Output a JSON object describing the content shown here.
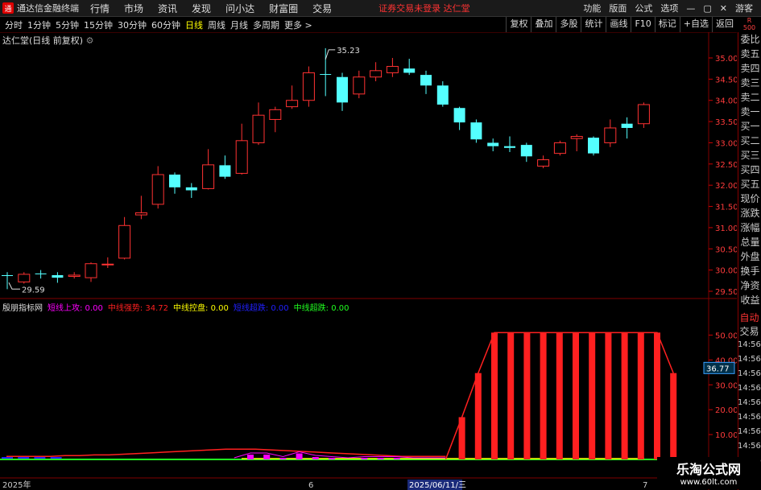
{
  "app": {
    "title": "通达信金融终端",
    "menus": [
      "行情",
      "市场",
      "资讯",
      "发现",
      "问小达",
      "财富圈",
      "交易"
    ],
    "notice": "证券交易未登录  达仁堂",
    "right_menus": [
      "功能",
      "版面",
      "公式",
      "选项"
    ],
    "guest": "游客"
  },
  "periods": {
    "items": [
      "分时",
      "1分钟",
      "5分钟",
      "15分钟",
      "30分钟",
      "60分钟",
      "日线",
      "周线",
      "月线",
      "多周期",
      "更多 >"
    ],
    "active": "日线"
  },
  "tools": [
    "复权",
    "叠加",
    "多股",
    "统计",
    "画线",
    "F10",
    "标记",
    "+自选",
    "返回"
  ],
  "right_top": {
    "line1": "R",
    "line2": "500"
  },
  "stock_title": "达仁堂(日线 前复权)",
  "price_axis": [
    "35.00",
    "34.50",
    "34.00",
    "33.50",
    "33.00",
    "32.50",
    "32.00",
    "31.50",
    "31.00",
    "30.50",
    "30.00",
    "29.50"
  ],
  "annotations": {
    "high": "35.23",
    "low": "29.59"
  },
  "right_panel": [
    "委比",
    "卖五",
    "卖四",
    "卖三",
    "卖二",
    "卖一",
    "买一",
    "买二",
    "买三",
    "买四",
    "买五",
    "现价",
    "涨跌",
    "涨幅",
    "总量",
    "外盘",
    "换手",
    "净资",
    "收益"
  ],
  "indicator": {
    "name": "殷朋指标网",
    "items": [
      {
        "label": "短线上攻: 0.00",
        "color": "#ff00ff"
      },
      {
        "label": "中线强势: 34.72",
        "color": "#ff2020"
      },
      {
        "label": "中线控盘: 0.00",
        "color": "#ffff00"
      },
      {
        "label": "短线超跌: 0.00",
        "color": "#2020ff"
      },
      {
        "label": "中线超跌: 0.00",
        "color": "#20ff20"
      }
    ],
    "axis": [
      "50.00",
      "40.00",
      "30.00",
      "20.00",
      "10.00"
    ],
    "current": "36.77"
  },
  "ind_side": {
    "auto": "自动",
    "trade": "交易",
    "times": [
      "14:56",
      "14:56",
      "14:56",
      "14:56",
      "14:56",
      "14:56",
      "14:56",
      "14:56",
      "14:56"
    ]
  },
  "dates": {
    "start": "2025年",
    "mid": "6",
    "cursor": "2025/06/11/三",
    "end": "7"
  },
  "watermark": {
    "line1": "乐淘公式网",
    "line2": "www.60lt.com"
  },
  "chart_data": [
    {
      "type": "candlestick",
      "title": "达仁堂(日线 前复权)",
      "ylim": [
        29.3,
        35.2
      ],
      "candles": [
        {
          "o": 29.88,
          "c": 29.86,
          "h": 29.95,
          "l": 29.55,
          "up": false
        },
        {
          "o": 29.72,
          "c": 29.9,
          "h": 29.95,
          "l": 29.68,
          "up": true
        },
        {
          "o": 29.92,
          "c": 29.9,
          "h": 30.0,
          "l": 29.8,
          "up": false
        },
        {
          "o": 29.88,
          "c": 29.82,
          "h": 29.95,
          "l": 29.7,
          "up": false
        },
        {
          "o": 29.85,
          "c": 29.88,
          "h": 29.95,
          "l": 29.8,
          "up": true
        },
        {
          "o": 29.82,
          "c": 30.15,
          "h": 30.18,
          "l": 29.72,
          "up": true
        },
        {
          "o": 30.14,
          "c": 30.14,
          "h": 30.3,
          "l": 30.05,
          "up": true
        },
        {
          "o": 30.28,
          "c": 31.05,
          "h": 31.25,
          "l": 30.25,
          "up": true
        },
        {
          "o": 31.3,
          "c": 31.35,
          "h": 31.75,
          "l": 31.2,
          "up": true
        },
        {
          "o": 31.55,
          "c": 32.25,
          "h": 32.45,
          "l": 31.45,
          "up": true
        },
        {
          "o": 32.25,
          "c": 31.95,
          "h": 32.3,
          "l": 31.8,
          "up": false
        },
        {
          "o": 31.95,
          "c": 31.88,
          "h": 32.05,
          "l": 31.7,
          "up": false
        },
        {
          "o": 31.92,
          "c": 32.48,
          "h": 32.85,
          "l": 31.9,
          "up": true
        },
        {
          "o": 32.47,
          "c": 32.2,
          "h": 32.7,
          "l": 32.15,
          "up": false
        },
        {
          "o": 32.28,
          "c": 33.05,
          "h": 33.45,
          "l": 32.25,
          "up": true
        },
        {
          "o": 33.0,
          "c": 33.65,
          "h": 33.95,
          "l": 32.95,
          "up": true
        },
        {
          "o": 33.55,
          "c": 33.78,
          "h": 33.85,
          "l": 33.25,
          "up": true
        },
        {
          "o": 33.85,
          "c": 34.0,
          "h": 34.35,
          "l": 33.8,
          "up": true
        },
        {
          "o": 34.0,
          "c": 34.65,
          "h": 34.8,
          "l": 33.85,
          "up": true
        },
        {
          "o": 34.62,
          "c": 34.62,
          "h": 35.23,
          "l": 34.1,
          "up": false
        },
        {
          "o": 34.55,
          "c": 33.95,
          "h": 34.65,
          "l": 33.75,
          "up": false
        },
        {
          "o": 34.15,
          "c": 34.55,
          "h": 34.7,
          "l": 34.05,
          "up": true
        },
        {
          "o": 34.55,
          "c": 34.7,
          "h": 34.9,
          "l": 34.45,
          "up": true
        },
        {
          "o": 34.65,
          "c": 34.8,
          "h": 35.0,
          "l": 34.55,
          "up": true
        },
        {
          "o": 34.75,
          "c": 34.65,
          "h": 34.98,
          "l": 34.6,
          "up": false
        },
        {
          "o": 34.6,
          "c": 34.35,
          "h": 34.7,
          "l": 34.15,
          "up": false
        },
        {
          "o": 34.35,
          "c": 33.9,
          "h": 34.45,
          "l": 33.85,
          "up": false
        },
        {
          "o": 33.82,
          "c": 33.48,
          "h": 33.85,
          "l": 33.3,
          "up": false
        },
        {
          "o": 33.48,
          "c": 33.08,
          "h": 33.55,
          "l": 33.0,
          "up": false
        },
        {
          "o": 33.0,
          "c": 32.92,
          "h": 33.1,
          "l": 32.8,
          "up": false
        },
        {
          "o": 32.92,
          "c": 32.88,
          "h": 33.15,
          "l": 32.78,
          "up": false
        },
        {
          "o": 32.95,
          "c": 32.68,
          "h": 33.0,
          "l": 32.55,
          "up": false
        },
        {
          "o": 32.45,
          "c": 32.6,
          "h": 32.7,
          "l": 32.4,
          "up": true
        },
        {
          "o": 32.75,
          "c": 33.0,
          "h": 33.05,
          "l": 32.7,
          "up": true
        },
        {
          "o": 33.1,
          "c": 33.15,
          "h": 33.2,
          "l": 32.8,
          "up": true
        },
        {
          "o": 33.12,
          "c": 32.75,
          "h": 33.15,
          "l": 32.7,
          "up": false
        },
        {
          "o": 33.0,
          "c": 33.35,
          "h": 33.55,
          "l": 32.9,
          "up": true
        },
        {
          "o": 33.35,
          "c": 33.45,
          "h": 33.6,
          "l": 33.1,
          "up": false
        },
        {
          "o": 33.45,
          "c": 33.9,
          "h": 33.95,
          "l": 33.35,
          "up": true
        }
      ]
    },
    {
      "type": "bar",
      "title": "殷朋指标网",
      "ylim": [
        0,
        55
      ],
      "series": [
        {
          "name": "中线强势",
          "values": [
            0,
            0,
            0,
            0,
            0,
            0,
            0,
            0,
            0,
            0,
            0,
            0,
            0,
            0,
            0,
            0,
            0,
            0,
            0,
            0,
            0,
            0,
            0,
            0,
            0,
            0,
            0,
            0,
            17,
            34.72,
            51,
            51,
            51,
            51,
            51,
            51,
            51,
            51,
            51,
            51,
            51,
            34.72
          ]
        },
        {
          "name": "短线上攻",
          "values": [
            0,
            0,
            0,
            0,
            0,
            0,
            0,
            0,
            0,
            0,
            0,
            0,
            0,
            0,
            0,
            2,
            2,
            0.5,
            2.5,
            1,
            0.5,
            0,
            0.5,
            0.5,
            0.5,
            0,
            0,
            0,
            0,
            0,
            0,
            0,
            0,
            0,
            0,
            0,
            0,
            0,
            0,
            0,
            0,
            0
          ]
        },
        {
          "name": "短线超跌",
          "values": [
            0.5,
            0.5,
            0.5,
            0.5,
            0,
            0,
            0,
            0,
            0,
            0,
            0,
            0,
            0,
            0,
            0,
            0,
            0,
            0,
            0,
            0,
            0,
            0,
            0,
            0,
            0,
            0,
            0,
            0,
            0,
            0,
            0,
            0,
            0,
            0,
            0,
            0,
            0,
            0,
            0,
            0,
            0,
            0
          ]
        }
      ]
    }
  ]
}
